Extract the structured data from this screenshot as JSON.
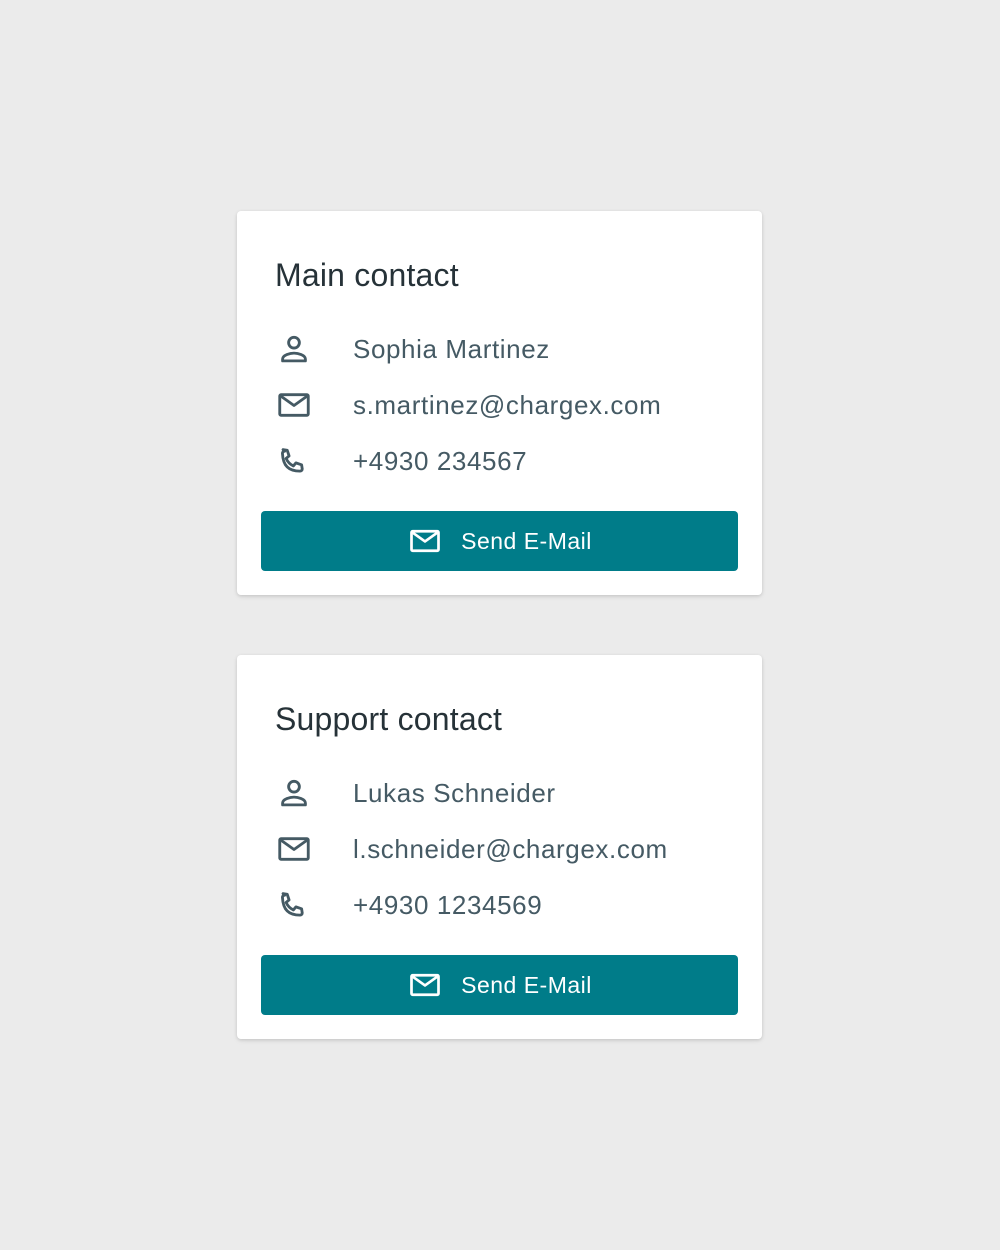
{
  "colors": {
    "background": "#ebebeb",
    "card": "#ffffff",
    "title": "#263238",
    "text": "#455a64",
    "accent": "#007c89"
  },
  "cards": [
    {
      "title": "Main contact",
      "name": "Sophia Martinez",
      "email": "s.martinez@chargex.com",
      "phone": "+4930 234567",
      "button_label": "Send E-Mail",
      "icons": [
        "person-icon",
        "mail-icon",
        "phone-icon",
        "mail-icon"
      ]
    },
    {
      "title": "Support contact",
      "name": "Lukas Schneider",
      "email": "l.schneider@chargex.com",
      "phone": "+4930 1234569",
      "button_label": "Send E-Mail",
      "icons": [
        "person-icon",
        "mail-icon",
        "phone-icon",
        "mail-icon"
      ]
    }
  ]
}
